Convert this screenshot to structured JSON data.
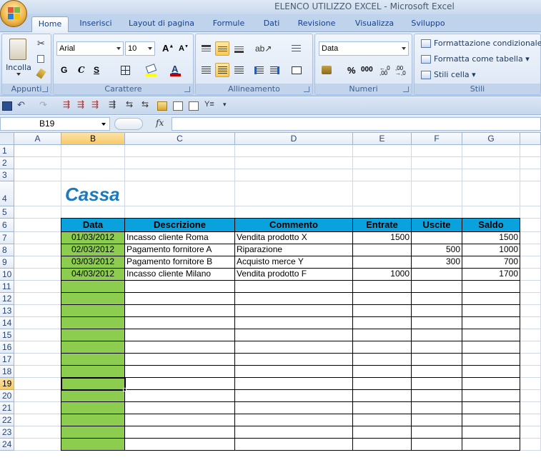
{
  "window": {
    "title": "ELENCO UTILIZZO EXCEL - Microsoft Excel"
  },
  "tabs": [
    "Home",
    "Inserisci",
    "Layout di pagina",
    "Formule",
    "Dati",
    "Revisione",
    "Visualizza",
    "Sviluppo"
  ],
  "ribbon": {
    "clipboard": {
      "paste_label": "Incolla",
      "group_label": "Appunti"
    },
    "font": {
      "font_name": "Arial",
      "font_size": "10",
      "bold": "G",
      "italic": "C",
      "underline": "S",
      "group_label": "Carattere"
    },
    "alignment": {
      "group_label": "Allineamento"
    },
    "number": {
      "format": "Data",
      "percent": "%",
      "thousands": "000",
      "group_label": "Numeri"
    },
    "styles": {
      "conditional": "Formattazione condizionale",
      "table": "Formatta come tabella",
      "cell_styles": "Stili cella",
      "group_label": "Stili"
    }
  },
  "formula_bar": {
    "name_box": "B19",
    "fx": "fx",
    "content": ""
  },
  "columns": [
    "A",
    "B",
    "C",
    "D",
    "E",
    "F",
    "G"
  ],
  "rows": [
    "1",
    "2",
    "3",
    "4",
    "5",
    "6",
    "7",
    "8",
    "9",
    "10",
    "11",
    "12",
    "13",
    "14",
    "15",
    "16",
    "17",
    "18",
    "19",
    "20",
    "21",
    "22",
    "23",
    "24"
  ],
  "selected": {
    "column": "B",
    "row": "19"
  },
  "sheet": {
    "title": "Cassa",
    "headers": [
      "Data",
      "Descrizione",
      "Commento",
      "Entrate",
      "Uscite",
      "Saldo"
    ],
    "records": [
      [
        "01/03/2012",
        "Incasso cliente Roma",
        "Vendita prodotto X",
        "1500",
        "",
        "1500"
      ],
      [
        "02/03/2012",
        "Pagamento fornitore A",
        "Riparazione",
        "",
        "500",
        "1000"
      ],
      [
        "03/03/2012",
        "Pagamento fornitore B",
        "Acquisto merce Y",
        "",
        "300",
        "700"
      ],
      [
        "04/03/2012",
        "Incasso cliente Milano",
        "Vendita prodotto F",
        "1000",
        "",
        "1700"
      ]
    ]
  },
  "colors": {
    "header_fill": "#0aa2dd",
    "date_fill": "#8ccc4e",
    "title_color": "#1a7abf"
  }
}
